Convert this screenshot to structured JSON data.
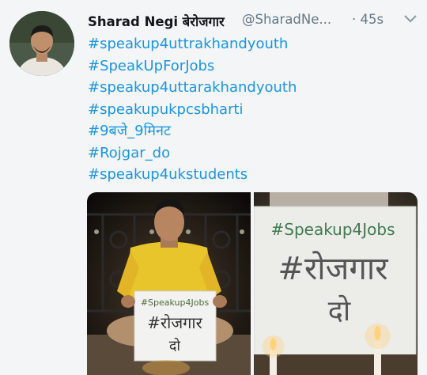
{
  "tweet": {
    "author_name": "Sharad Negi बेरोजगार",
    "author_handle": "@SharadNe...",
    "timestamp": "· 45s",
    "hashtags": [
      "#speakup4uttrakhandyouth",
      "#SpeakUpForJobs",
      "#speakup4uttarakhandyouth",
      "#speakupukpcsbharti",
      "#9बजे_9मिनट",
      "#Rojgar_do",
      "#speakup4ukstudents"
    ]
  },
  "photos": {
    "photo1": {
      "sign_line1": "#Speakup4Jobs",
      "sign_line2": "#रोजगार",
      "sign_line3": "दो"
    },
    "photo2": {
      "sign_line1": "#Speakup4Jobs",
      "sign_line2": "#रोजगार",
      "sign_line3": "दो"
    }
  },
  "colors": {
    "link": "#1b95e0",
    "name": "#14171a",
    "muted": "#657786"
  }
}
